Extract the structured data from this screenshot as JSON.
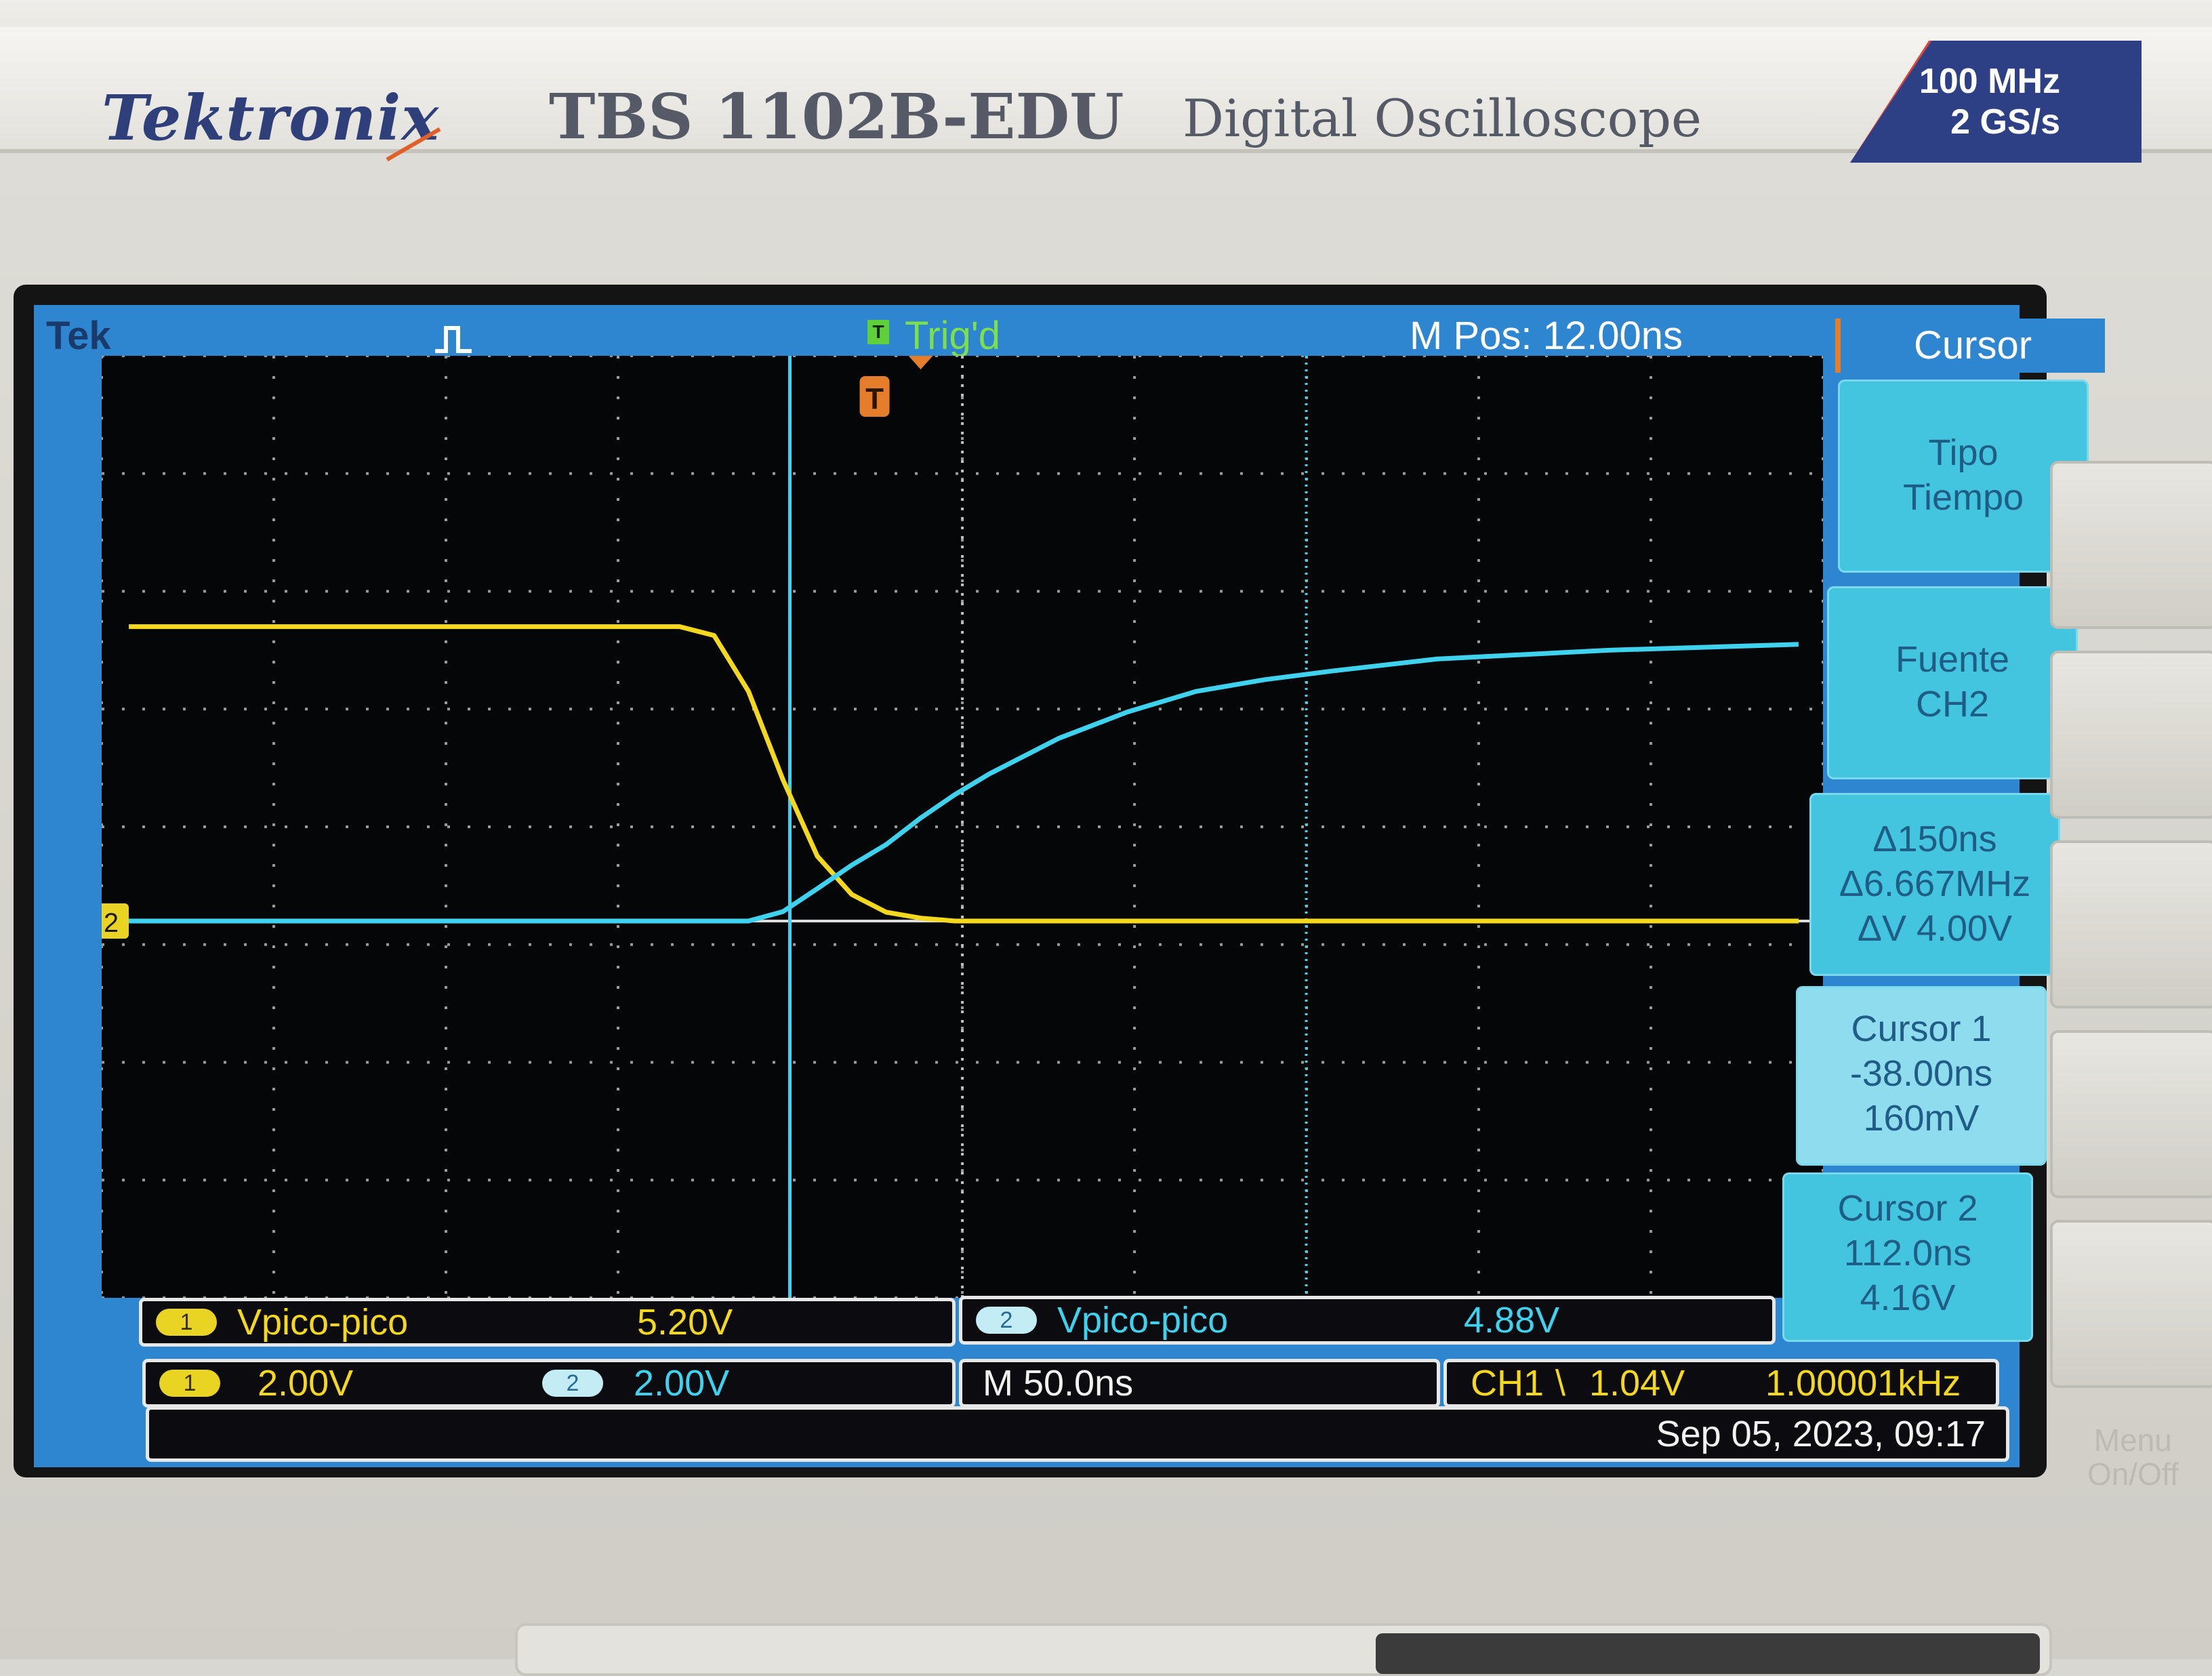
{
  "brand": {
    "logo": "Tektronix",
    "model": "TBS 1102B-EDU",
    "description": "Digital Oscilloscope",
    "bandwidth": "100 MHz",
    "sample_rate": "2 GS/s"
  },
  "topbar": {
    "tek_label": "Tek",
    "trigger_icon": "T",
    "trigger_status": "Trig'd",
    "m_pos": "M Pos: 12.00ns",
    "acquisition_icon": "pulse-icon",
    "trigger_marker": "T",
    "channel2_marker": "2"
  },
  "menu": {
    "title": "Cursor",
    "buttons": [
      {
        "lines": [
          "Tipo",
          "Tiempo"
        ]
      },
      {
        "lines": [
          "Fuente",
          "CH2"
        ]
      },
      {
        "lines": [
          "Δ150ns",
          "Δ6.667MHz",
          "ΔV 4.00V"
        ]
      },
      {
        "lines": [
          "Cursor 1",
          "-38.00ns",
          "160mV"
        ]
      },
      {
        "lines": [
          "Cursor 2",
          "112.0ns",
          "4.16V"
        ]
      }
    ]
  },
  "measurements": {
    "ch1_chip": "1",
    "ch1_label": "Vpico-pico",
    "ch1_value": "5.20V",
    "ch2_chip": "2",
    "ch2_label": "Vpico-pico",
    "ch2_value": "4.88V"
  },
  "status": {
    "ch1_chip": "1",
    "ch1_scale": "2.00V",
    "ch2_chip": "2",
    "ch2_scale": "2.00V",
    "timebase": "M 50.0ns",
    "trigger_source": "CH1",
    "trigger_slope": "\\",
    "trigger_level": "1.04V",
    "frequency": "1.00001kHz",
    "date": "Sep 05, 2023, 09:17"
  },
  "side_label": {
    "line1": "Menu",
    "line2": "On/Off"
  },
  "colors": {
    "ch1": "#f4d81e",
    "ch2": "#3fd2ee",
    "screen_frame": "#2d86cf",
    "menu_accent": "#e67d2a"
  },
  "chart_data": {
    "type": "line",
    "xlabel": "",
    "ylabel": "",
    "x_unit": "ns",
    "y_unit": "V",
    "xlim": [
      -237.9,
      262.1
    ],
    "ylim": [
      -6.4,
      9.6
    ],
    "grid": true,
    "series": [
      {
        "name": "1",
        "x": [
          -230,
          -70,
          -60,
          -50,
          -40,
          -30,
          -20,
          -10,
          0,
          10,
          20,
          40,
          60,
          100,
          180,
          255
        ],
        "values": [
          5.0,
          5.0,
          4.85,
          3.9,
          2.4,
          1.1,
          0.45,
          0.15,
          0.05,
          0.0,
          0.0,
          0.0,
          0.0,
          0.0,
          0.0,
          0.0
        ]
      },
      {
        "name": "2",
        "x": [
          -230,
          -50,
          -40,
          -30,
          -20,
          -10,
          0,
          10,
          20,
          40,
          60,
          80,
          100,
          120,
          150,
          200,
          255
        ],
        "values": [
          0.0,
          0.0,
          0.16,
          0.55,
          0.95,
          1.3,
          1.75,
          2.15,
          2.5,
          3.1,
          3.55,
          3.9,
          4.1,
          4.25,
          4.45,
          4.6,
          4.7
        ]
      }
    ],
    "cursors": {
      "cursor1": {
        "time": -38.0,
        "voltage": 0.16
      },
      "cursor2": {
        "time": 112.0,
        "voltage": 4.16
      }
    },
    "trigger": {
      "time": 0,
      "level": 1.04
    }
  }
}
